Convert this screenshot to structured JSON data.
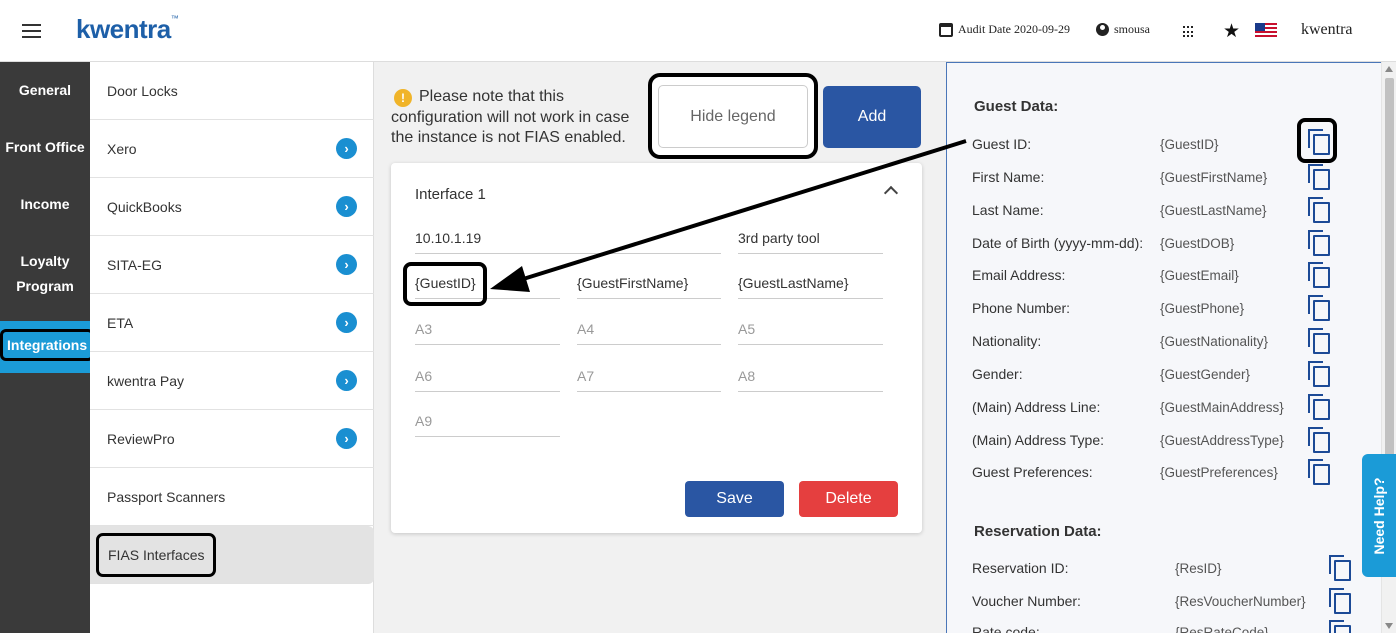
{
  "header": {
    "logo": "kwentra",
    "logo_tm": "™",
    "audit_date": "Audit Date 2020-09-29",
    "user": "smousa",
    "brand": "kwentra"
  },
  "leftnav": {
    "general": "General",
    "front_office": "Front Office",
    "income": "Income",
    "loyalty_line1": "Loyalty",
    "loyalty_line2": "Program",
    "integrations": "Integrations"
  },
  "subnav": {
    "items": [
      {
        "label": "Door Locks"
      },
      {
        "label": "Xero"
      },
      {
        "label": "QuickBooks"
      },
      {
        "label": "SITA-EG"
      },
      {
        "label": "ETA"
      },
      {
        "label": "kwentra Pay"
      },
      {
        "label": "ReviewPro"
      },
      {
        "label": "Passport Scanners"
      },
      {
        "label": "FIAS Interfaces"
      }
    ],
    "chevron": "›"
  },
  "main": {
    "warning_icon": "!",
    "warning": "Please note that this configuration will not work in case the instance is not FIAS enabled.",
    "hide_legend": "Hide legend",
    "add": "Add",
    "card": {
      "title": "Interface 1",
      "ip": "10.10.1.19",
      "tool": "3rd party tool",
      "fields": [
        "{GuestID}",
        "{GuestFirstName}",
        "{GuestLastName}",
        "A3",
        "A4",
        "A5",
        "A6",
        "A7",
        "A8",
        "A9"
      ],
      "save": "Save",
      "delete": "Delete"
    }
  },
  "legend": {
    "guest_title": "Guest Data:",
    "guest": [
      {
        "label": "Guest ID:",
        "value": "{GuestID}"
      },
      {
        "label": "First Name:",
        "value": "{GuestFirstName}"
      },
      {
        "label": "Last Name:",
        "value": "{GuestLastName}"
      },
      {
        "label": "Date of Birth (yyyy-mm-dd):",
        "value": "{GuestDOB}"
      },
      {
        "label": "Email Address:",
        "value": "{GuestEmail}"
      },
      {
        "label": "Phone Number:",
        "value": "{GuestPhone}"
      },
      {
        "label": "Nationality:",
        "value": "{GuestNationality}"
      },
      {
        "label": "Gender:",
        "value": "{GuestGender}"
      },
      {
        "label": "(Main) Address Line:",
        "value": "{GuestMainAddress}"
      },
      {
        "label": "(Main) Address Type:",
        "value": "{GuestAddressType}"
      },
      {
        "label": "Guest Preferences:",
        "value": "{GuestPreferences}"
      }
    ],
    "reservation_title": "Reservation Data:",
    "reservation": [
      {
        "label": "Reservation ID:",
        "value": "{ResID}"
      },
      {
        "label": "Voucher Number:",
        "value": "{ResVoucherNumber}"
      },
      {
        "label": "Rate code:",
        "value": "{ResRateCode}"
      }
    ]
  },
  "help": "Need Help?",
  "colors": {
    "primary_blue": "#2a56a3",
    "accent_blue": "#1b9bd7",
    "danger_red": "#e53f3f",
    "nav_dark": "#3a3a3a"
  }
}
